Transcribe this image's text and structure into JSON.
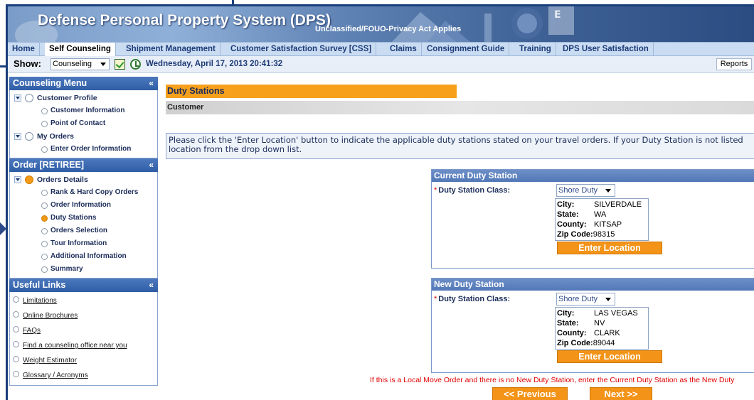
{
  "banner": {
    "title": "Defense Personal Property System (DPS)",
    "classification": "Unclassified/FOUO-Privacy Act Applies"
  },
  "tabs": [
    {
      "label": "Home",
      "active": false
    },
    {
      "label": "Self Counseling",
      "active": true
    },
    {
      "label": "Shipment Management",
      "active": false
    },
    {
      "label": "Customer Satisfaction Survey [CSS]",
      "active": false
    },
    {
      "label": "Claims",
      "active": false
    },
    {
      "label": "Consignment Guide",
      "active": false
    },
    {
      "label": "Training",
      "active": false
    },
    {
      "label": "DPS User Satisfaction",
      "active": false
    }
  ],
  "toolbar": {
    "show_label": "Show:",
    "show_value": "Counseling",
    "datetime": "Wednesday, April 17, 2013 20:41:32",
    "reports_label": "Reports"
  },
  "counseling_menu": {
    "title": "Counseling Menu",
    "collapse": "«",
    "items": [
      {
        "label": "Customer Profile",
        "level": 1
      },
      {
        "label": "Customer Information",
        "level": 2
      },
      {
        "label": "Point of Contact",
        "level": 2
      },
      {
        "label": "My Orders",
        "level": 1
      },
      {
        "label": "Enter Order Information",
        "level": 2
      }
    ]
  },
  "order_menu": {
    "title": "Order [RETIREE]",
    "collapse": "«",
    "items": [
      {
        "label": "Orders Details",
        "level": 1,
        "current": true
      },
      {
        "label": "Rank & Hard Copy Orders",
        "level": 2
      },
      {
        "label": "Order Information",
        "level": 2
      },
      {
        "label": "Duty Stations",
        "level": 2,
        "current": true
      },
      {
        "label": "Orders Selection",
        "level": 2
      },
      {
        "label": "Tour Information",
        "level": 2
      },
      {
        "label": "Additional Information",
        "level": 2
      },
      {
        "label": "Summary",
        "level": 2
      }
    ]
  },
  "useful_links": {
    "title": "Useful Links",
    "collapse": "«",
    "items": [
      "Limitations",
      "Online Brochures",
      "FAQs",
      "Find a counseling office near you",
      "Weight Estimator",
      "Glossary / Acronyms"
    ]
  },
  "main": {
    "section_title": "Duty Stations",
    "customer_label": "Customer",
    "instructions": "Please click the 'Enter Location' button to indicate the applicable duty stations stated on your travel orders. If your Duty Station is not listed",
    "instructions_line2": "location from the drop down list.",
    "current_station": {
      "title": "Current Duty Station",
      "class_label": "Duty Station Class:",
      "class_value": "Shore Duty",
      "city_label": "City:",
      "city": "SILVERDALE",
      "state_label": "State:",
      "state": "WA",
      "county_label": "County:",
      "county": "KITSAP",
      "zip_label": "Zip Code:",
      "zip": "98315",
      "button": "Enter Location"
    },
    "new_station": {
      "title": "New Duty Station",
      "class_label": "Duty Station Class:",
      "class_value": "Shore Duty",
      "city_label": "City:",
      "city": "LAS VEGAS",
      "state_label": "State:",
      "state": "NV",
      "county_label": "County:",
      "county": "CLARK",
      "zip_label": "Zip Code:",
      "zip": "89044",
      "button": "Enter Location"
    },
    "local_move_note": "If this is a Local Move Order and there is no New Duty Station, enter the Current Duty Station as the New Duty",
    "previous_button": "<< Previous",
    "next_button": "Next >>"
  },
  "colors": {
    "accent_orange": "#f39318",
    "nav_blue": "#2f5ea6",
    "frame_blue": "#1a3f7a",
    "note_red": "#e00000"
  }
}
